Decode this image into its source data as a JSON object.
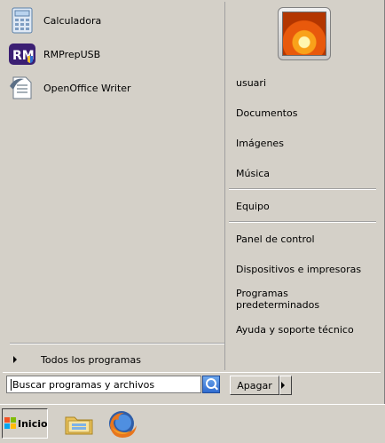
{
  "pinned": [
    {
      "label": "Calculadora",
      "icon": "calculator-icon"
    },
    {
      "label": "RMPrepUSB",
      "icon": "rmprepusb-icon",
      "logo_text": "RM"
    },
    {
      "label": "OpenOffice Writer",
      "icon": "openoffice-writer-icon"
    }
  ],
  "all_programs": {
    "label": "Todos los programas"
  },
  "right_items": {
    "user": "usuari",
    "documents": "Documentos",
    "pictures": "Imágenes",
    "music": "Música",
    "computer": "Equipo",
    "control_panel": "Panel de control",
    "devices": "Dispositivos e impresoras",
    "default_programs": "Programas predeterminados",
    "help": "Ayuda y soporte técnico"
  },
  "search": {
    "placeholder": "Buscar programas y archivos"
  },
  "shutdown": {
    "label": "Apagar"
  },
  "taskbar": {
    "start_label": "Inicio",
    "pinned": [
      {
        "icon": "windows-explorer-icon"
      },
      {
        "icon": "firefox-icon"
      }
    ]
  },
  "colors": {
    "face": "#d4d0c8",
    "search_button": "#2f6bd0"
  }
}
